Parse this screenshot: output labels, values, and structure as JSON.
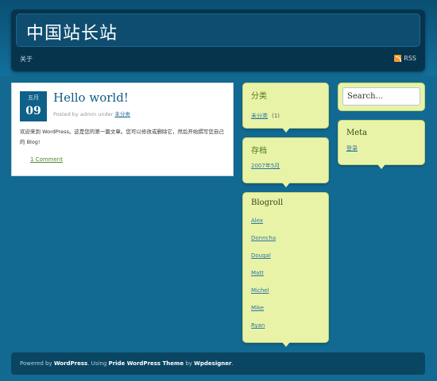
{
  "header": {
    "site_title": "中国站长站",
    "nav": {
      "home": "关于"
    },
    "rss_label": "RSS"
  },
  "post": {
    "date_month": "五月",
    "date_day": "09",
    "title": "Hello world!",
    "meta_prefix": "Posted by admin under",
    "meta_category": "未分类",
    "body": "欢迎来到 WordPress。这是您的第一篇文章。您可以修改或删除它，然后开始撰写您自己的 Blog!",
    "comments": "1 Comment"
  },
  "sidebar": {
    "categories": {
      "title": "分类",
      "items": [
        {
          "label": "未分类",
          "count": "(1)"
        }
      ]
    },
    "archives": {
      "title": "存档",
      "items": [
        "2007年5月"
      ]
    },
    "blogroll": {
      "title": "Blogroll",
      "items": [
        "Alex",
        "Donncha",
        "Dougal",
        "Matt",
        "Michel",
        "Mike",
        "Ryan"
      ]
    },
    "search": {
      "placeholder": "Search..."
    },
    "meta": {
      "title": "Meta",
      "items": [
        "登录"
      ]
    }
  },
  "footer": {
    "powered_by": "Powered by",
    "wordpress": "WordPress",
    "using": ". Using",
    "theme": "Pride WordPress Theme",
    "by": "by",
    "designer": "Wpdesigner",
    "end": "."
  },
  "colors": {
    "background": "#126a93",
    "header": "#07344d",
    "widget": "#e9f3a8",
    "date_badge": "#0e6189"
  }
}
